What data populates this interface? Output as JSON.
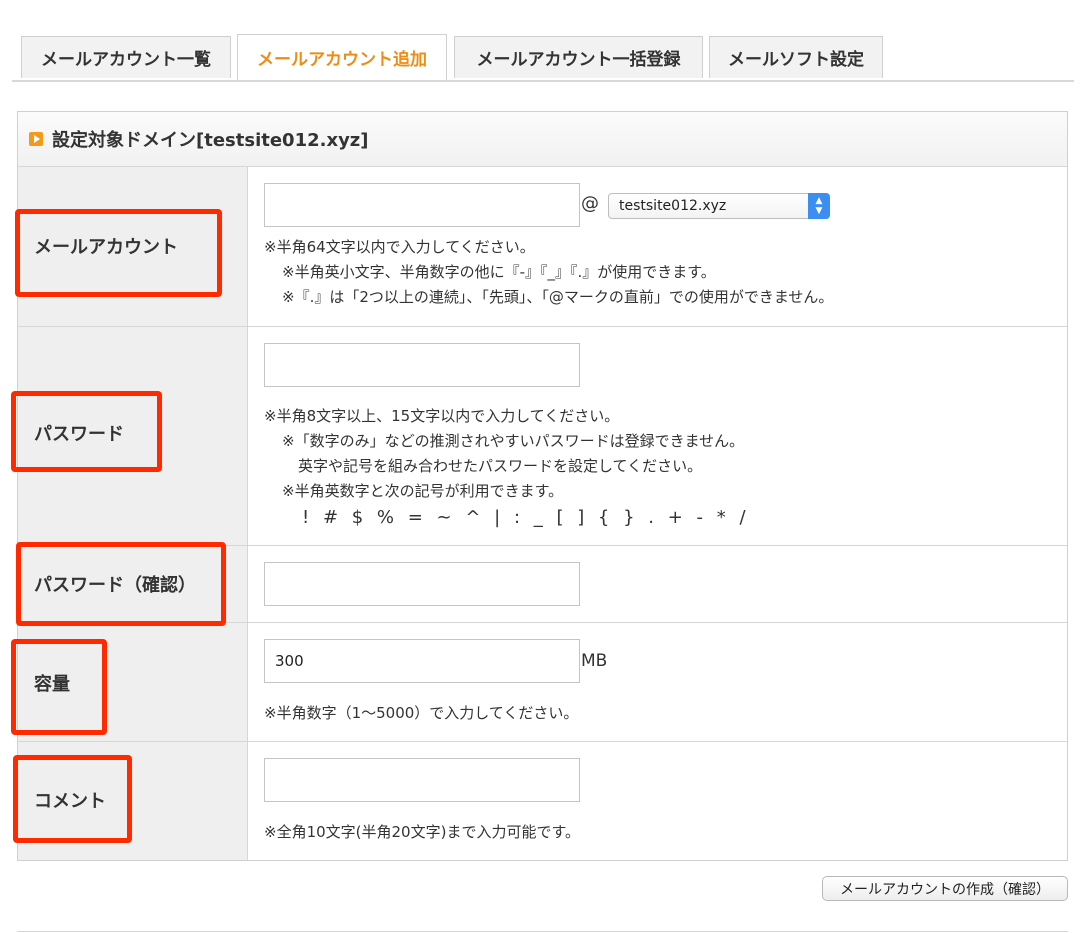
{
  "tabs": [
    {
      "label": "メールアカウント一覧",
      "active": false
    },
    {
      "label": "メールアカウント追加",
      "active": true
    },
    {
      "label": "メールアカウント一括登録",
      "active": false
    },
    {
      "label": "メールソフト設定",
      "active": false
    }
  ],
  "panel": {
    "title": "設定対象ドメイン[testsite012.xyz]"
  },
  "form": {
    "account": {
      "label": "メールアカウント",
      "value": "",
      "at": "@",
      "domain_selected": "testsite012.xyz",
      "notes": [
        "※半角64文字以内で入力してください。",
        "※半角英小文字、半角数字の他に『-』『_』『.』が使用できます。",
        "※『.』は「2つ以上の連続」、「先頭」、「@マークの直前」での使用ができません。"
      ]
    },
    "password": {
      "label": "パスワード",
      "value": "",
      "notes": [
        "※半角8文字以上、15文字以内で入力してください。",
        "※「数字のみ」などの推測されやすいパスワードは登録できません。",
        "英字や記号を組み合わせたパスワードを設定してください。",
        "※半角英数字と次の記号が利用できます。",
        "! # $ % = ~ ^ | : _ [ ] { } . + - * /"
      ]
    },
    "password_confirm": {
      "label": "パスワード（確認）",
      "value": ""
    },
    "capacity": {
      "label": "容量",
      "value": "300",
      "unit": "MB",
      "note": "※半角数字（1〜5000）で入力してください。"
    },
    "comment": {
      "label": "コメント",
      "value": "",
      "note": "※全角10文字(半角20文字)まで入力可能です。"
    }
  },
  "submit_label": "メールアカウントの作成（確認）",
  "colors": {
    "active_tab": "#f08b14",
    "highlight": "#ff2a00",
    "select_accent": "#3c8ef0"
  }
}
